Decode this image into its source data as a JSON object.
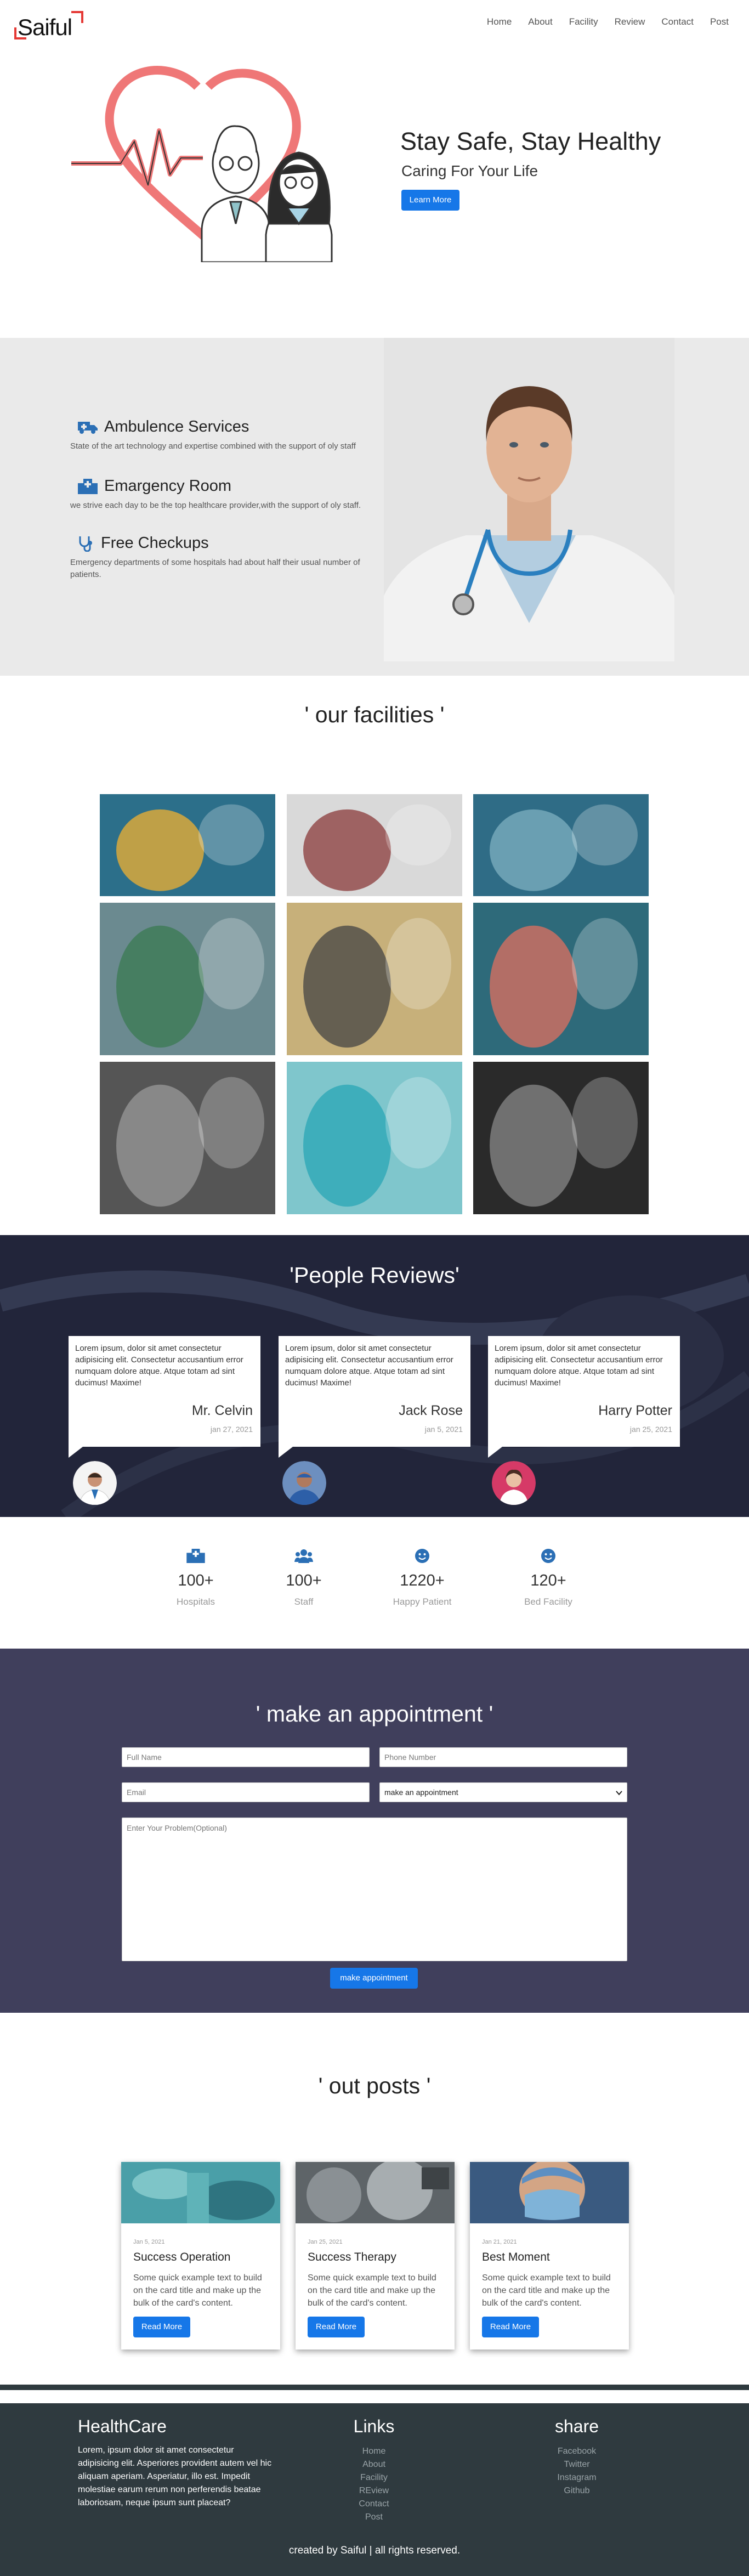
{
  "nav": {
    "logo": "Saiful",
    "links": [
      "Home",
      "About",
      "Facility",
      "Review",
      "Contact",
      "Post"
    ]
  },
  "hero": {
    "title": "Stay Safe, Stay Healthy",
    "subtitle": "Caring For Your Life",
    "button": "Learn More"
  },
  "services": [
    {
      "icon": "ambulance-icon",
      "title": "Ambulence Services",
      "desc": "State of the art technology and expertise combined with the support of oly staff"
    },
    {
      "icon": "hospital-icon",
      "title": "Emargency Room",
      "desc": "we strive each day to be the top healthcare provider,with the support of oly staff."
    },
    {
      "icon": "stethoscope-icon",
      "title": "Free Checkups",
      "desc": "Emergency departments of some hospitals had about half their usual number of patients."
    }
  ],
  "facilities": {
    "title": "' our facilities '"
  },
  "reviews": {
    "title": "'People Reviews'",
    "items": [
      {
        "text": "Lorem ipsum, dolor sit amet consectetur adipisicing elit. Consectetur accusantium error numquam dolore atque. Atque totam ad sint ducimus! Maxime!",
        "name": "Mr. Celvin",
        "date": "jan 27, 2021"
      },
      {
        "text": "Lorem ipsum, dolor sit amet consectetur adipisicing elit. Consectetur accusantium error numquam dolore atque. Atque totam ad sint ducimus! Maxime!",
        "name": "Jack Rose",
        "date": "jan 5, 2021"
      },
      {
        "text": "Lorem ipsum, dolor sit amet consectetur adipisicing elit. Consectetur accusantium error numquam dolore atque. Atque totam ad sint ducimus! Maxime!",
        "name": "Harry Potter",
        "date": "jan 25, 2021"
      }
    ]
  },
  "stats": [
    {
      "icon": "hospital-icon",
      "num": "100+",
      "label": "Hospitals"
    },
    {
      "icon": "users-icon",
      "num": "100+",
      "label": "Staff"
    },
    {
      "icon": "smile-icon",
      "num": "1220+",
      "label": "Happy Patient"
    },
    {
      "icon": "smile-icon",
      "num": "120+",
      "label": "Bed Facility"
    }
  ],
  "appointment": {
    "title": "' make an appointment '",
    "full_name": "Full Name",
    "phone": "Phone Number",
    "email": "Email",
    "select": "make an appointment",
    "problem": "Enter Your Problem(Optional)",
    "button": "make appointment"
  },
  "posts": {
    "title": "' out posts '",
    "items": [
      {
        "date": "Jan 5, 2021",
        "title": "Success Operation",
        "desc": "Some quick example text to build on the card title and make up the bulk of the card's content.",
        "button": "Read More"
      },
      {
        "date": "Jan 25, 2021",
        "title": "Success Therapy",
        "desc": "Some quick example text to build on the card title and make up the bulk of the card's content.",
        "button": "Read More"
      },
      {
        "date": "Jan 21, 2021",
        "title": "Best Moment",
        "desc": "Some quick example text to build on the card title and make up the bulk of the card's content.",
        "button": "Read More"
      }
    ]
  },
  "footer": {
    "brand": "HealthCare",
    "about": "Lorem, ipsum dolor sit amet consectetur adipisicing elit. Asperiores provident autem vel hic aliquam aperiam. Asperiatur, illo est. Impedit molestiae earum rerum non perferendis beatae laboriosam, neque ipsum sunt placeat?",
    "links_title": "Links",
    "links": [
      "Home",
      "About",
      "Facility",
      "REview",
      "Contact",
      "Post"
    ],
    "share_title": "share",
    "share": [
      "Facebook",
      "Twitter",
      "Instagram",
      "Github"
    ],
    "copyright": "created by Saiful | all rights reserved."
  },
  "colors": {
    "accent": "#1677e8",
    "logo_red": "#e53935",
    "services_bg": "#eaeaea",
    "reviews_bg": "#23263a",
    "appointment_bg": "#403f5c",
    "footer_bg": "#2f3a3f"
  }
}
